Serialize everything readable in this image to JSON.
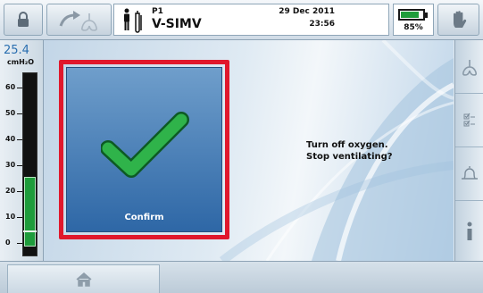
{
  "header": {
    "patient_id": "P1",
    "mode": "V-SIMV",
    "date": "29 Dec 2011",
    "time": "23:56",
    "battery_percent_label": "85%",
    "battery_level": 0.85,
    "buttons": [
      "lock-icon",
      "standby-icon",
      "hand-icon"
    ]
  },
  "gauge": {
    "value": "25.4",
    "unit": "cmH₂O",
    "ticks": [
      "60",
      "50",
      "40",
      "30",
      "20",
      "10",
      "0"
    ],
    "range": [
      -5,
      66
    ],
    "fill_range": [
      -1,
      26
    ],
    "marker_value": 5
  },
  "dialog": {
    "confirm_label": "Confirm",
    "message_line1": "Turn off oxygen.",
    "message_line2": "Stop ventilating?"
  },
  "sidebar": {
    "items": [
      "lungs-icon",
      "checklist-icon",
      "alarm-bell-icon",
      "info-icon"
    ]
  },
  "bottom": {
    "home_icon": "home-icon"
  },
  "colors": {
    "confirm_highlight": "#e0182c",
    "accent_green": "#1f9c3a",
    "confirm_blue": "#3b74b0"
  }
}
